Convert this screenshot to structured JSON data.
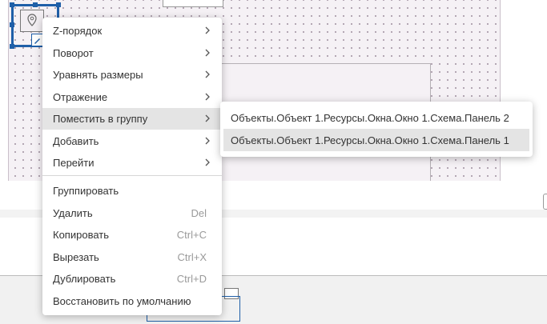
{
  "context_menu": {
    "items": [
      {
        "label": "Z-порядок",
        "submenu": true
      },
      {
        "label": "Поворот",
        "submenu": true
      },
      {
        "label": "Уравнять размеры",
        "submenu": true
      },
      {
        "label": "Отражение",
        "submenu": true
      },
      {
        "label": "Поместить в группу",
        "submenu": true,
        "active": true
      },
      {
        "label": "Добавить",
        "submenu": true
      },
      {
        "label": "Перейти",
        "submenu": true
      }
    ],
    "actions": [
      {
        "label": "Группировать",
        "shortcut": ""
      },
      {
        "label": "Удалить",
        "shortcut": "Del"
      },
      {
        "label": "Копировать",
        "shortcut": "Ctrl+C"
      },
      {
        "label": "Вырезать",
        "shortcut": "Ctrl+X"
      },
      {
        "label": "Дублировать",
        "shortcut": "Ctrl+D"
      },
      {
        "label": "Восстановить по умолчанию",
        "shortcut": ""
      }
    ]
  },
  "submenu": {
    "items": [
      {
        "label": "Объекты.Объект 1.Ресурсы.Окна.Окно 1.Схема.Панель 2"
      },
      {
        "label": "Объекты.Объект 1.Ресурсы.Окна.Окно 1.Схема.Панель 1",
        "highlighted": true
      }
    ]
  },
  "icons": {
    "chevron": "chevron-right-icon",
    "element_icon": "map-pin-icon",
    "edit_icon": "pencil-icon"
  },
  "colors": {
    "selection": "#1f5fa8",
    "active_item_bg": "#e4e4e4",
    "canvas_bg": "#f5f1f5"
  }
}
